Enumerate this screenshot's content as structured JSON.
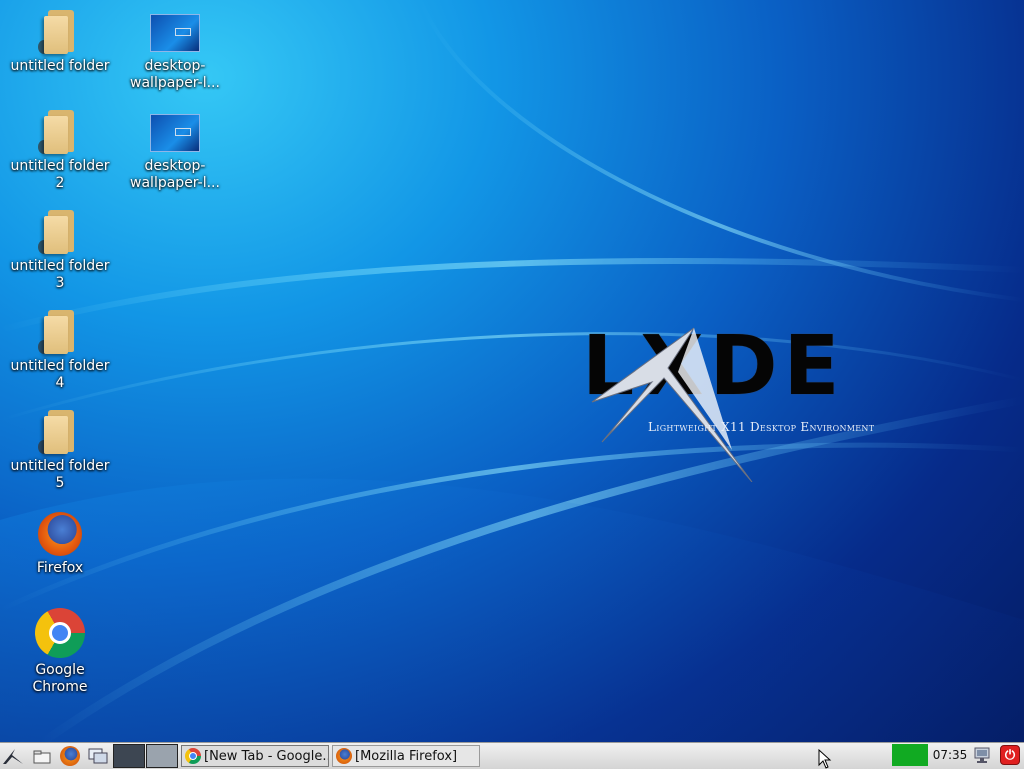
{
  "desktop": {
    "icons": [
      {
        "label": "untitled folder",
        "kind": "folder-icon"
      },
      {
        "label": "desktop-\nwallpaper-l...",
        "kind": "image-file-icon"
      },
      {
        "label": "untitled folder\n2",
        "kind": "folder-icon"
      },
      {
        "label": "desktop-\nwallpaper-l...",
        "kind": "image-file-icon"
      },
      {
        "label": "untitled folder\n3",
        "kind": "folder-icon"
      },
      {
        "label": "untitled folder\n4",
        "kind": "folder-icon"
      },
      {
        "label": "untitled folder\n5",
        "kind": "folder-icon"
      },
      {
        "label": "Firefox",
        "kind": "firefox-icon"
      },
      {
        "label": "Google\nChrome",
        "kind": "chrome-icon"
      }
    ]
  },
  "wallpaper": {
    "logo_letters": "LXDE",
    "logo_subtitle": "Lightweight X11 Desktop Environment"
  },
  "taskbar": {
    "tasks": [
      {
        "label": "[New Tab - Google...",
        "icon": "chrome-icon"
      },
      {
        "label": "[Mozilla Firefox]",
        "icon": "firefox-icon"
      }
    ],
    "clock": "07:35"
  },
  "colors": {
    "taskbar_bg": "#d4d4d4",
    "tray_green": "#11aa22",
    "power_red": "#e02020"
  }
}
